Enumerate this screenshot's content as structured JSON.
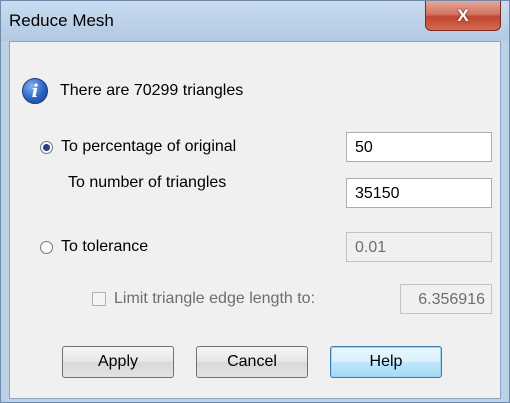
{
  "window": {
    "title": "Reduce Mesh",
    "close_label": "X"
  },
  "info": {
    "icon": "info-icon",
    "icon_glyph": "i",
    "message": "There are 70299 triangles"
  },
  "options": {
    "percentage": {
      "label": "To percentage of original",
      "value": "50",
      "selected": true
    },
    "triangles": {
      "label": "To number of triangles",
      "value": "35150"
    },
    "tolerance": {
      "label": "To tolerance",
      "value": "0.01",
      "selected": false
    },
    "limit_edge": {
      "label": "Limit triangle edge length to:",
      "value": "6.356916",
      "checked": false
    }
  },
  "buttons": {
    "apply": "Apply",
    "cancel": "Cancel",
    "help": "Help"
  },
  "colors": {
    "close_button": "#c2452f",
    "focus_button_border": "#3c7fb1",
    "radio_dot": "#2b3d8f"
  }
}
